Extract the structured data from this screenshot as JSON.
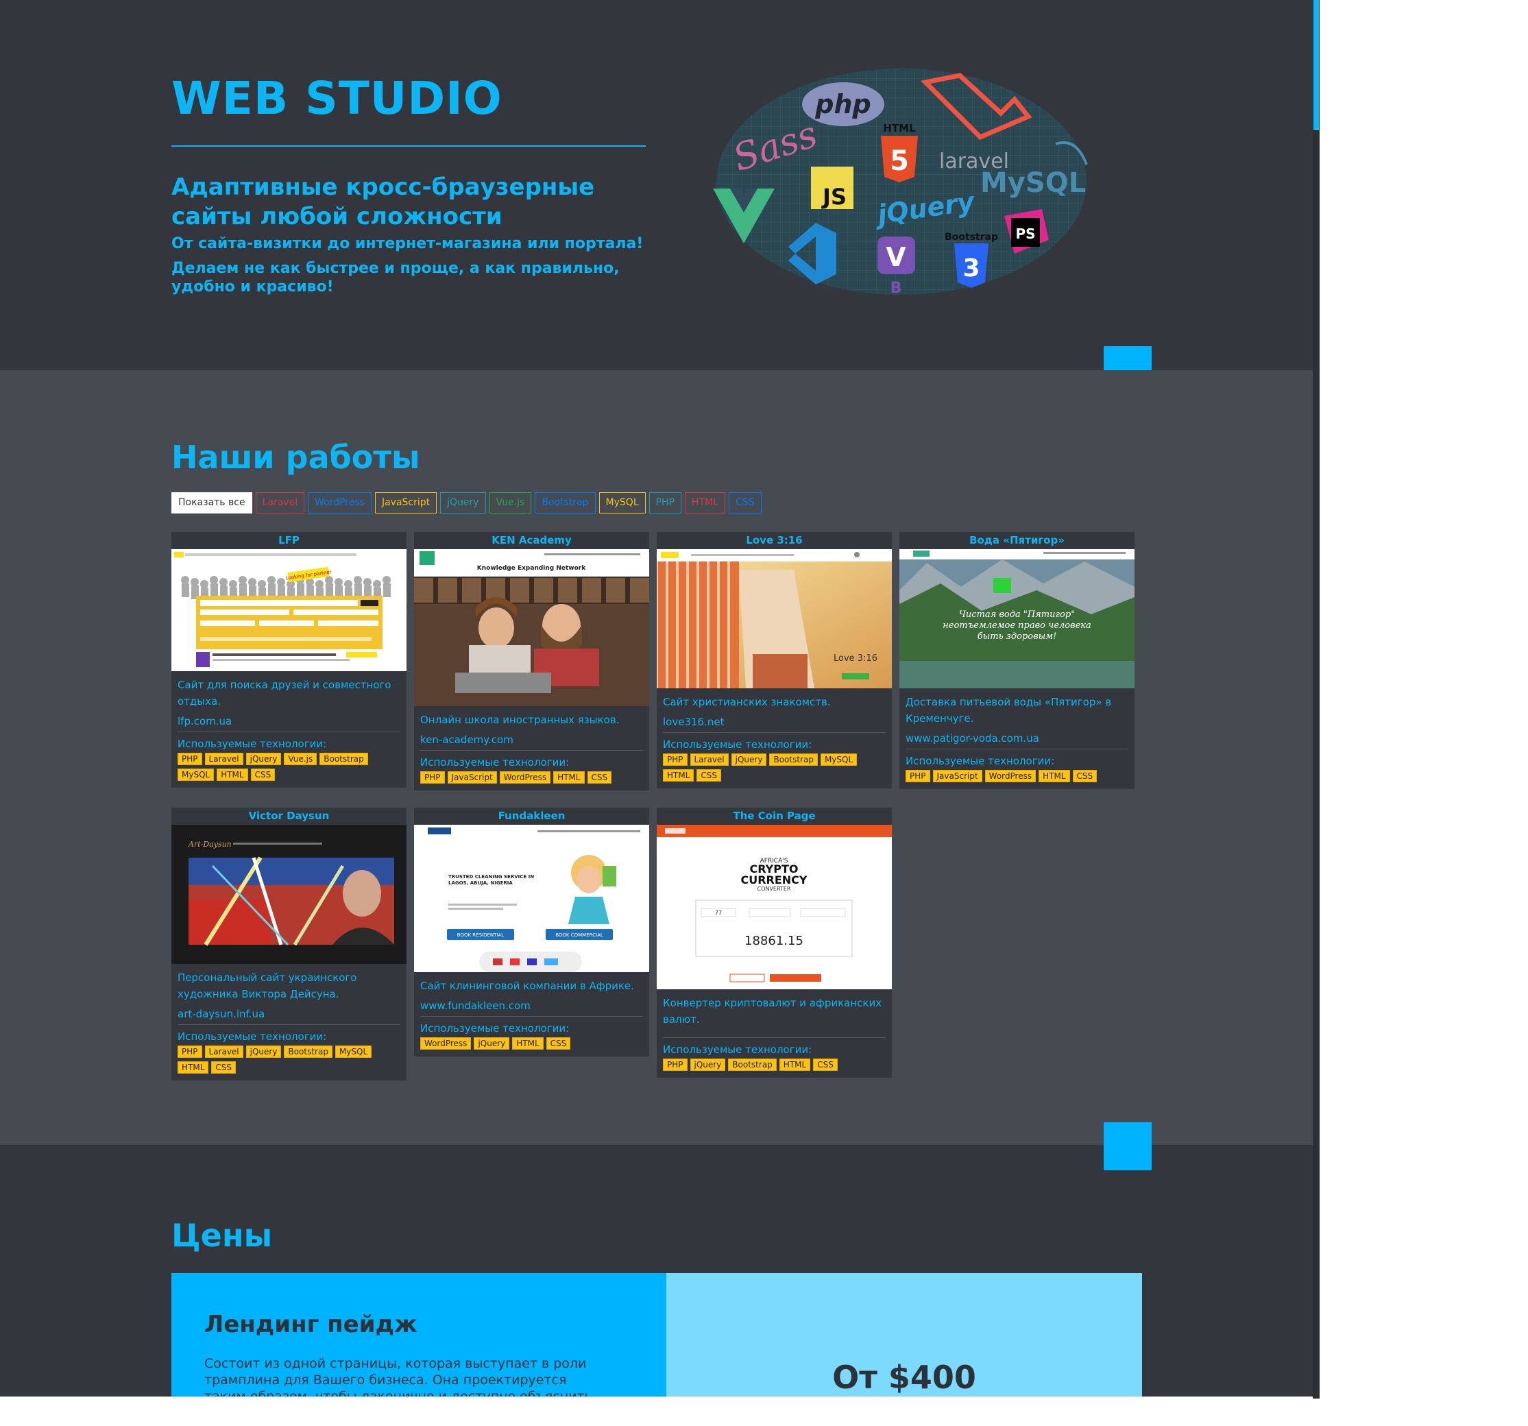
{
  "hero": {
    "logo": "WEB STUDIO",
    "headline": "Адаптивные кросс-браузерные сайты любой сложности",
    "line1": "От сайта-визитки до интернет-магазина или портала!",
    "line2": "Делаем не как быстрее и проще, а как правильно, удобно и красиво!",
    "tech_cloud": [
      "php",
      "Sass",
      "HTML",
      "laravel",
      "JS",
      "jQuery",
      "MySQL",
      "V",
      "B",
      "Bootstrap",
      "CSS",
      "PS"
    ]
  },
  "works": {
    "title": "Наши работы",
    "filters": [
      {
        "label": "Показать все",
        "color": "#ffffff",
        "active": true
      },
      {
        "label": "Laravel",
        "color": "#dc3545"
      },
      {
        "label": "WordPress",
        "color": "#007bff"
      },
      {
        "label": "JavaScript",
        "color": "#ffc107"
      },
      {
        "label": "jQuery",
        "color": "#17a2b8"
      },
      {
        "label": "Vue.js",
        "color": "#28a745"
      },
      {
        "label": "Bootstrap",
        "color": "#007bff"
      },
      {
        "label": "MySQL",
        "color": "#ffc107"
      },
      {
        "label": "PHP",
        "color": "#17a2b8"
      },
      {
        "label": "HTML",
        "color": "#dc3545"
      },
      {
        "label": "CSS",
        "color": "#007bff"
      }
    ],
    "tech_label": "Используемые технологии:",
    "cards": [
      {
        "title": "LFP",
        "desc": "Сайт для поиска друзей и совместного отдыха.",
        "url": "lfp.com.ua",
        "tags": [
          "PHP",
          "Laravel",
          "jQuery",
          "Vue.js",
          "Bootstrap",
          "MySQL",
          "HTML",
          "CSS"
        ]
      },
      {
        "title": "KEN Academy",
        "desc": "Онлайн школа иностранных языков.",
        "url": "ken-academy.com",
        "tags": [
          "PHP",
          "JavaScript",
          "WordPress",
          "HTML",
          "CSS"
        ]
      },
      {
        "title": "Love 3:16",
        "desc": "Сайт христианских знакомств.",
        "url": "love316.net",
        "tags": [
          "PHP",
          "Laravel",
          "jQuery",
          "Bootstrap",
          "MySQL",
          "HTML",
          "CSS"
        ]
      },
      {
        "title": "Вода «Пятигор»",
        "desc": "Доставка питьевой воды «Пятигор» в Кременчуге.",
        "url": "www.patigor-voda.com.ua",
        "tags": [
          "PHP",
          "JavaScript",
          "WordPress",
          "HTML",
          "CSS"
        ]
      },
      {
        "title": "Victor Daysun",
        "desc": "Персональный сайт украинского художника Виктора Дейсуна.",
        "url": "art-daysun.inf.ua",
        "tags": [
          "PHP",
          "Laravel",
          "jQuery",
          "Bootstrap",
          "MySQL",
          "HTML",
          "CSS"
        ]
      },
      {
        "title": "Fundakleen",
        "desc": "Сайт клининговой компании в Африке.",
        "url": "www.fundakleen.com",
        "tags": [
          "WordPress",
          "jQuery",
          "HTML",
          "CSS"
        ]
      },
      {
        "title": "The Coin Page",
        "desc": "Конвертер криптовалют и африканских валют.",
        "url": "",
        "tags": [
          "PHP",
          "jQuery",
          "Bootstrap",
          "HTML",
          "CSS"
        ]
      }
    ],
    "shots": {
      "lfp": {
        "tagline": "Looking for partner"
      },
      "ken": {
        "heading": "Knowledge Expanding Network"
      },
      "love": {
        "heading": "Love 3:16"
      },
      "voda": {
        "text": "Чистая вода \"Пятигор\" неотъемлемое право человека быть здоровым!"
      },
      "art": {
        "brand": "Art-Daysun"
      },
      "funda": {
        "text": "TRUSTED CLEANING SERVICE IN LAGOS, ABUJA, NIGERIA",
        "btn1": "BOOK RESIDENTIAL",
        "btn2": "BOOK COMMERCIAL"
      },
      "coin": {
        "line1": "AFRICA'S",
        "line2": "CRYPTO",
        "line3": "CURRENCY",
        "line4": "CONVERTER",
        "amount": "77",
        "result": "18861.15"
      }
    }
  },
  "prices": {
    "title": "Цены",
    "plan_name": "Лендинг пейдж",
    "plan_desc": "Состоит из одной страницы, которая выступает в роли трамплина для Вашего бизнеса. Она проектируется таким образом, чтобы лаконично и доступно объяснить",
    "plan_price": "От $400"
  },
  "colors": {
    "accent": "#0cb5f3",
    "bg_dark": "#33363d",
    "bg_works": "#464b52",
    "tag": "#ffc20e"
  }
}
